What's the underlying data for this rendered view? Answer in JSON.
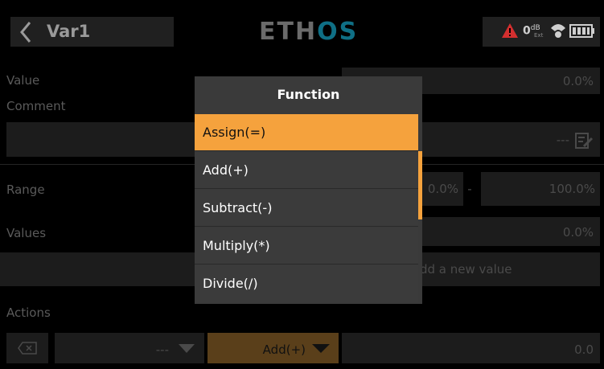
{
  "header": {
    "title": "Var1",
    "logo_main": "ETH",
    "logo_accent": "OS",
    "signal_value": "0",
    "signal_unit": "dB",
    "signal_source": "Ext"
  },
  "form": {
    "value_label": "Value",
    "value": "0.0%",
    "comment_label": "Comment",
    "comment_value": "---",
    "range_label": "Range",
    "range_min": "0.0%",
    "range_sep": "-",
    "range_max": "100.0%",
    "values_label": "Values",
    "values_value": "0.0%",
    "add_value_label": "dd a new value",
    "actions_label": "Actions",
    "action_source": "---",
    "action_function": "Add(+)",
    "action_value": "0.0"
  },
  "dialog": {
    "title": "Function",
    "options": [
      "Assign(=)",
      "Add(+)",
      "Subtract(-)",
      "Multiply(*)",
      "Divide(/)"
    ],
    "selected_index": 0
  },
  "colors": {
    "accent": "#f5a23d",
    "logo_accent": "#0f6f85",
    "warning": "#d32f2f"
  }
}
